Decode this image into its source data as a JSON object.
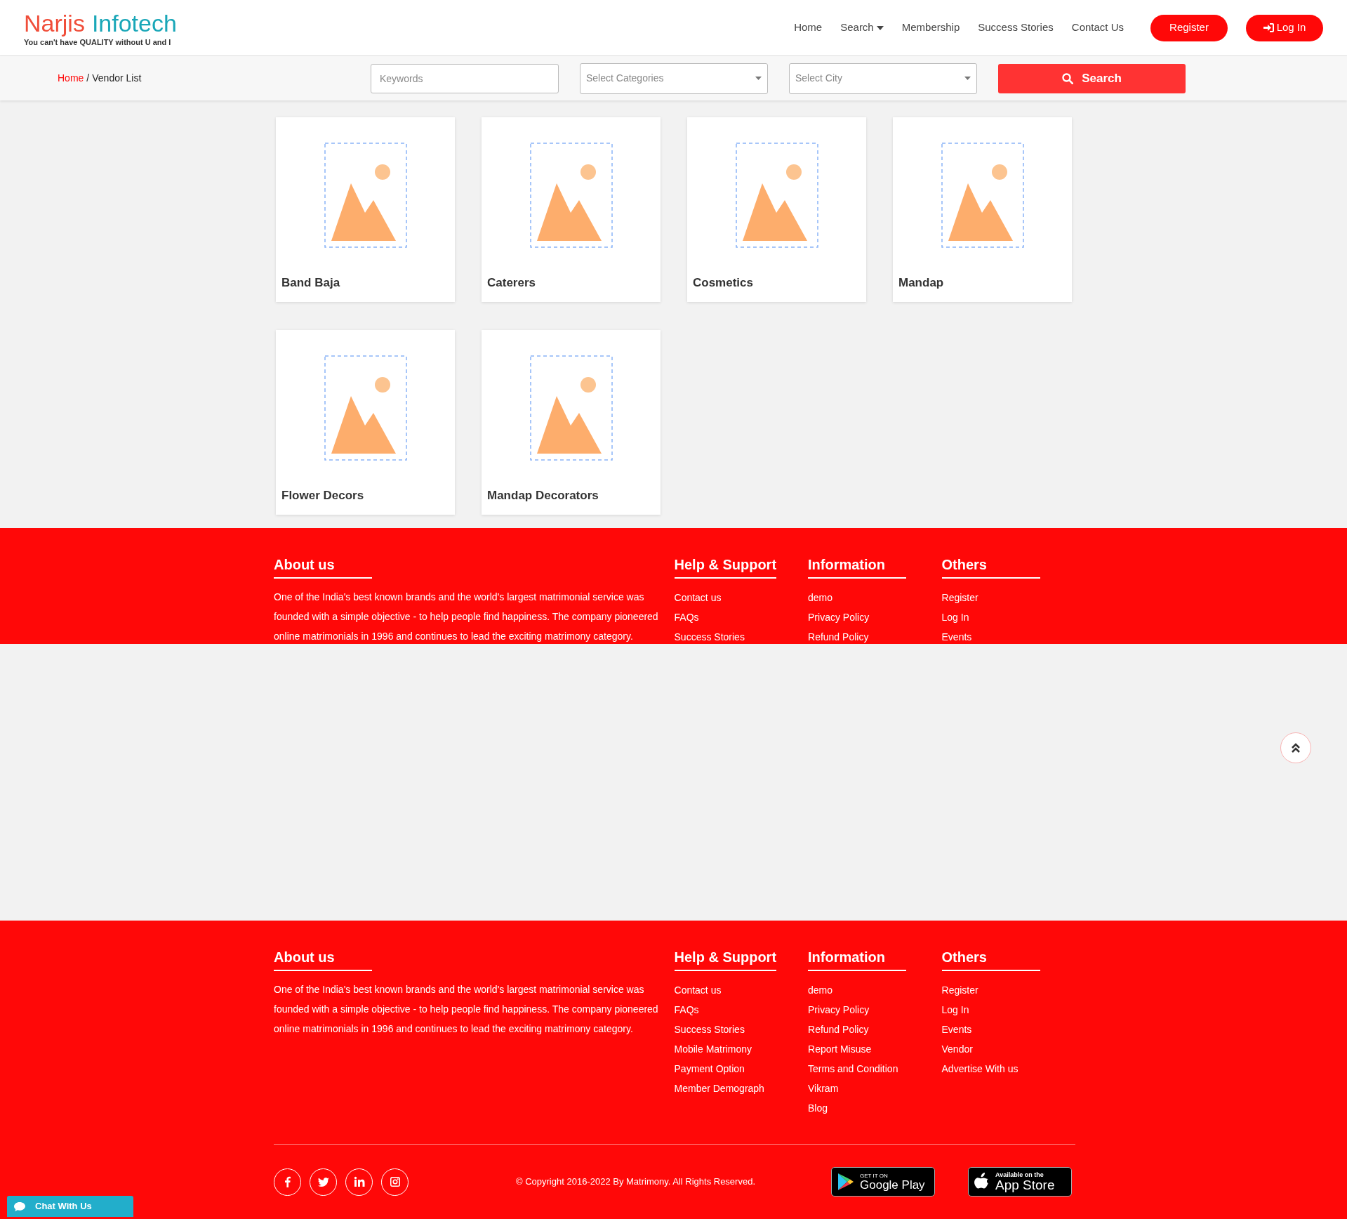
{
  "logo": {
    "name_left": "Narjis",
    "name_right": "Infotech",
    "tagline": "You can't have QUALITY without U and I"
  },
  "nav": [
    {
      "label": "Home",
      "dropdown": false
    },
    {
      "label": "Search",
      "dropdown": true
    },
    {
      "label": "Membership",
      "dropdown": false
    },
    {
      "label": "Success Stories",
      "dropdown": false
    },
    {
      "label": "Contact Us",
      "dropdown": false
    }
  ],
  "register_button": "Register",
  "login_button": "Log In",
  "breadcrumb": [
    {
      "label": "Home",
      "current": false
    },
    {
      "label": "Vendor List",
      "current": true
    }
  ],
  "breadcrumb_separator": "/",
  "search": {
    "keywords_placeholder": "Keywords",
    "categories_placeholder": "Select Categories",
    "city_placeholder": "Select City",
    "button": "Search"
  },
  "vendors": [
    {
      "name": "Band Baja"
    },
    {
      "name": "Caterers"
    },
    {
      "name": "Cosmetics"
    },
    {
      "name": "Mandap"
    },
    {
      "name": "Flower Decors"
    },
    {
      "name": "Mandap Decorators"
    }
  ],
  "footers": [
    {
      "about_heading": "About us",
      "about_text": "One of the India's best known brands and the world's largest matrimonial service was founded with a simple objective - to help people find happiness. The company pioneered online matrimonials in 1996 and continues to lead the exciting matrimony category.",
      "columns": [
        {
          "heading": "Help & Support",
          "links": [
            "Contact us",
            "FAQs",
            "Success Stories"
          ]
        },
        {
          "heading": "Information",
          "links": [
            "demo",
            "Privacy Policy",
            "Refund Policy"
          ]
        },
        {
          "heading": "Others",
          "links": [
            "Register",
            "Log In",
            "Events"
          ]
        }
      ]
    },
    {
      "about_heading": "About us",
      "about_text": "One of the India's best known brands and the world's largest matrimonial service was founded with a simple objective - to help people find happiness. The company pioneered online matrimonials in 1996 and continues to lead the exciting matrimony category.",
      "columns": [
        {
          "heading": "Help & Support",
          "links": [
            "Contact us",
            "FAQs",
            "Success Stories",
            "Mobile Matrimony",
            "Payment Option",
            "Member Demograph"
          ]
        },
        {
          "heading": "Information",
          "links": [
            "demo",
            "Privacy Policy",
            "Refund Policy",
            "Report Misuse",
            "Terms and Condition",
            "Vikram",
            "Blog"
          ]
        },
        {
          "heading": "Others",
          "links": [
            "Register",
            "Log In",
            "Events",
            "Vendor",
            "Advertise With us"
          ]
        }
      ]
    }
  ],
  "copyright": "© Copyright 2016-2022 By Matrimony. All Rights Reserved.",
  "google_play": {
    "small": "GET IT ON",
    "large": "Google Play"
  },
  "app_store": {
    "small": "Available on the",
    "large": "App Store"
  },
  "chat_label": "Chat With Us"
}
